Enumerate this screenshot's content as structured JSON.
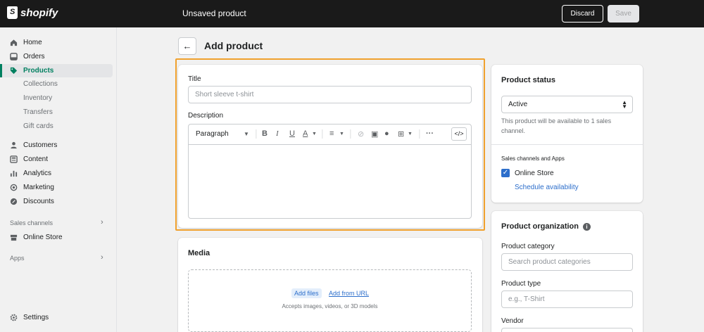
{
  "brand": {
    "name": "shopify"
  },
  "topbar": {
    "title": "Unsaved product",
    "discard_label": "Discard",
    "save_label": "Save"
  },
  "sidebar": {
    "items": [
      {
        "label": "Home",
        "icon": "home-icon"
      },
      {
        "label": "Orders",
        "icon": "orders-icon"
      },
      {
        "label": "Products",
        "icon": "tag-icon",
        "active": true
      },
      {
        "label": "Customers",
        "icon": "person-icon"
      },
      {
        "label": "Content",
        "icon": "content-icon"
      },
      {
        "label": "Analytics",
        "icon": "bars-icon"
      },
      {
        "label": "Marketing",
        "icon": "target-icon"
      },
      {
        "label": "Discounts",
        "icon": "discount-icon"
      }
    ],
    "product_sub": [
      "Collections",
      "Inventory",
      "Transfers",
      "Gift cards"
    ],
    "sales_channels_label": "Sales channels",
    "online_store_label": "Online Store",
    "apps_label": "Apps",
    "settings_label": "Settings"
  },
  "page": {
    "title": "Add product"
  },
  "product_form": {
    "title_label": "Title",
    "title_placeholder": "Short sleeve t-shirt",
    "description_label": "Description",
    "paragraph_label": "Paragraph"
  },
  "media": {
    "title": "Media",
    "add_files": "Add files",
    "add_from_url": "Add from URL",
    "accepts": "Accepts images, videos, or 3D models"
  },
  "status": {
    "title": "Product status",
    "value": "Active",
    "note": "This product will be available to 1 sales channel.",
    "channels_label": "Sales channels and Apps",
    "online_store": "Online Store",
    "schedule": "Schedule availability"
  },
  "organization": {
    "title": "Product organization",
    "category_label": "Product category",
    "category_placeholder": "Search product categories",
    "type_label": "Product type",
    "type_placeholder": "e.g., T-Shirt",
    "vendor_label": "Vendor"
  },
  "colors": {
    "accent": "#008060",
    "link": "#2c6ecb",
    "highlight": "#f0a12e",
    "topbar": "#1a1a1a"
  }
}
